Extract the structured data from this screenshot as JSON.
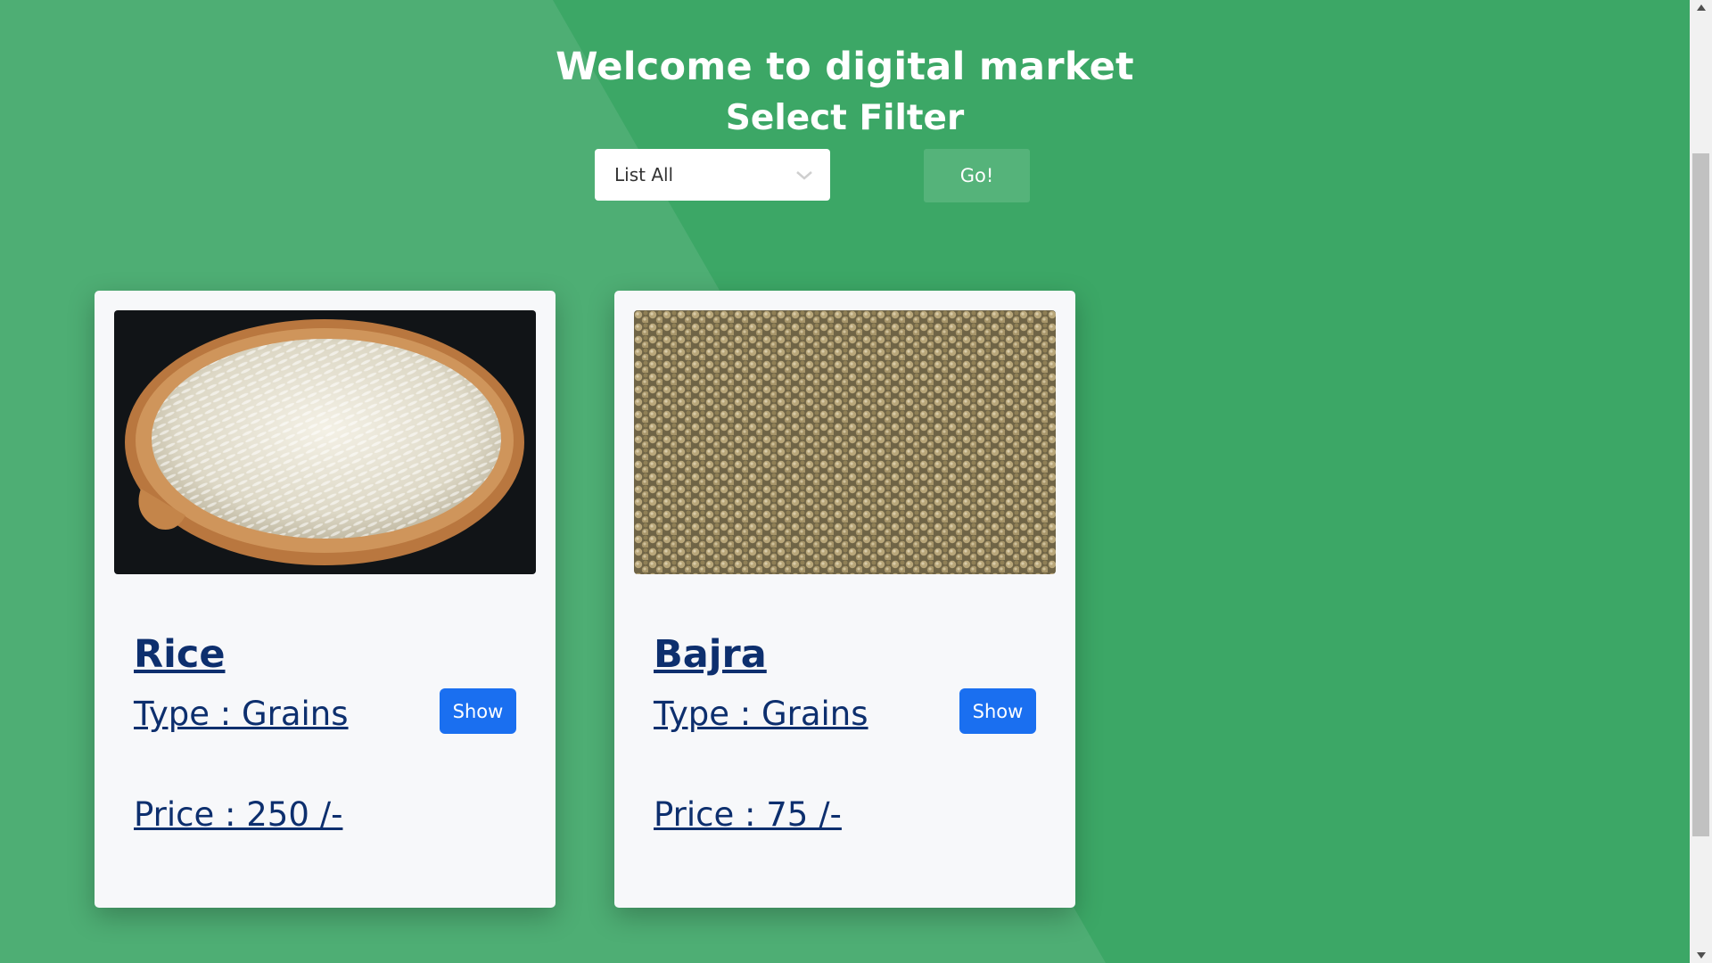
{
  "header": {
    "title": "Welcome to digital market",
    "subtitle": "Select Filter"
  },
  "filter": {
    "selected": "List All",
    "go_label": "Go!"
  },
  "products": [
    {
      "name": "Rice",
      "type_text": "Type : Grains",
      "price_text": "Price : 250 /-",
      "show_label": "Show",
      "image_icon": "rice-bowl-image"
    },
    {
      "name": "Bajra",
      "type_text": "Type : Grains",
      "price_text": "Price : 75 /-",
      "show_label": "Show",
      "image_icon": "bajra-grains-image"
    }
  ],
  "colors": {
    "background": "#3ca766",
    "card": "#f7f8fa",
    "link": "#0d2f6e",
    "show_button": "#1a6ff0",
    "go_button": "#55b37a"
  },
  "icons": {
    "select_chevron": "chevron-down-icon",
    "scroll_up": "arrow-up-icon",
    "scroll_down": "arrow-down-icon"
  }
}
